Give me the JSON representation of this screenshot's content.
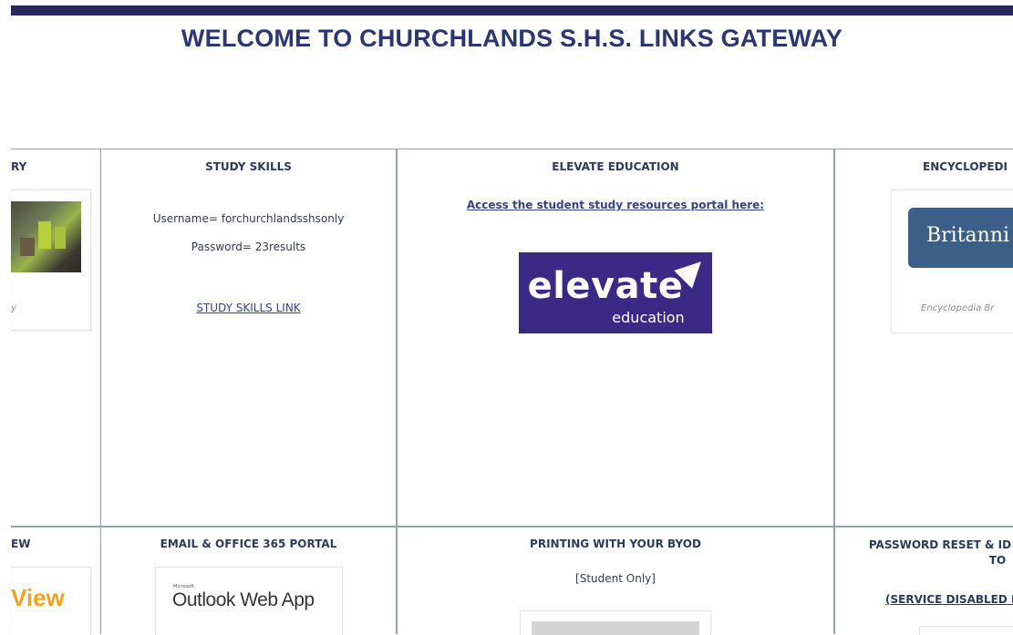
{
  "header": {
    "title": "WELCOME TO CHURCHLANDS S.H.S. LINKS GATEWAY"
  },
  "row1": {
    "library": {
      "title": "RY",
      "caption": "y"
    },
    "study_skills": {
      "title": "STUDY SKILLS",
      "username": "Username= forchurchlandsshsonly",
      "password": "Password= 23results",
      "link": "STUDY SKILLS LINK"
    },
    "elevate": {
      "title": "ELEVATE EDUCATION",
      "link": "Access the student study resources portal here:",
      "logo_word": "elevate",
      "logo_sub": "education",
      "logo_color": "#3a2a86"
    },
    "encyclopedia": {
      "title": "ENCYCLOPEDI",
      "logo_word": "Britanni",
      "caption": "Encyclopedia Br"
    }
  },
  "row2": {
    "view": {
      "title": "EW",
      "logo_word": "View"
    },
    "email": {
      "title": "EMAIL & OFFICE 365 PORTAL",
      "ms_small": "Microsoft",
      "logo_word": "Outlook Web App"
    },
    "printing": {
      "title": "PRINTING WITH YOUR BYOD",
      "note": "[Student Only]"
    },
    "password_reset": {
      "title_line1": "PASSWORD RESET & ID",
      "title_line2": "TO",
      "disabled": "(SERVICE DISABLED I"
    }
  }
}
